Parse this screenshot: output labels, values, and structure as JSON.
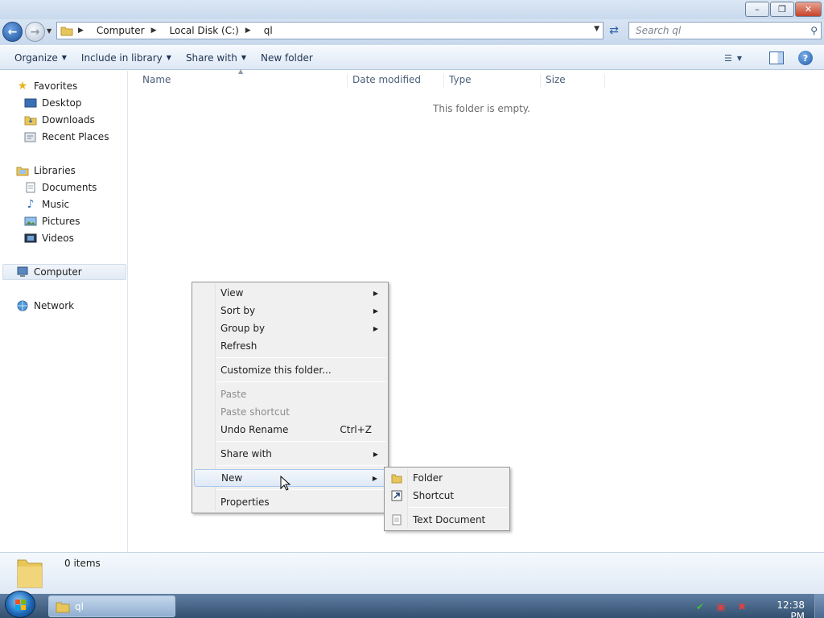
{
  "window": {
    "caption_buttons": {
      "minimize": "–",
      "maximize": "❐",
      "close": "✕"
    }
  },
  "address": {
    "breadcrumbs": [
      "Computer",
      "Local Disk (C:)",
      "ql"
    ],
    "search_placeholder": "Search ql"
  },
  "toolbar": {
    "organize": "Organize",
    "include_in_library": "Include in library",
    "share_with": "Share with",
    "new_folder": "New folder"
  },
  "nav": {
    "favorites": "Favorites",
    "desktop": "Desktop",
    "downloads": "Downloads",
    "recent_places": "Recent Places",
    "libraries": "Libraries",
    "documents": "Documents",
    "music": "Music",
    "pictures": "Pictures",
    "videos": "Videos",
    "computer": "Computer",
    "network": "Network"
  },
  "columns": {
    "name": "Name",
    "date_modified": "Date modified",
    "type": "Type",
    "size": "Size"
  },
  "content": {
    "empty_message": "This folder is empty."
  },
  "details": {
    "item_count": "0 items"
  },
  "context_menu": {
    "view": "View",
    "sort_by": "Sort by",
    "group_by": "Group by",
    "refresh": "Refresh",
    "customize": "Customize this folder...",
    "paste": "Paste",
    "paste_shortcut": "Paste shortcut",
    "undo_rename": "Undo Rename",
    "undo_shortcut": "Ctrl+Z",
    "share_with": "Share with",
    "new": "New",
    "properties": "Properties"
  },
  "new_submenu": {
    "folder": "Folder",
    "shortcut": "Shortcut",
    "text_document": "Text Document"
  },
  "taskbar": {
    "window_button": "ql",
    "clock": "12:38 PM"
  },
  "colors": {
    "accent": "#1d69b8",
    "menu_bg": "#f0f0f0",
    "folder_yellow": "#e8c659"
  }
}
